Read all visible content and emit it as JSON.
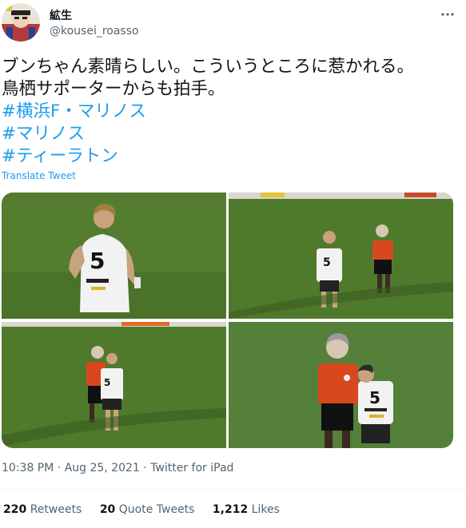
{
  "user": {
    "display_name": "絋生",
    "handle": "@kousei_roasso"
  },
  "tweet": {
    "lines": [
      "ブンちゃん素晴らしい。こういうところに惹かれる。",
      "鳥栖サポーターからも拍手。"
    ],
    "hashtags": [
      "#横浜F・マリノス",
      "#マリノス",
      "#ティーラトン"
    ],
    "translate_label": "Translate Tweet",
    "time": "10:38 PM",
    "date": "Aug 25, 2021",
    "source": "Twitter for iPad"
  },
  "stats": {
    "retweets_count": "220",
    "retweets_label": "Retweets",
    "quotes_count": "20",
    "quotes_label": "Quote Tweets",
    "likes_count": "1,212",
    "likes_label": "Likes"
  },
  "icons": [
    "avatar",
    "more-icon"
  ],
  "colors": {
    "link": "#1d9bf0",
    "secondary_text": "#536471",
    "primary_text": "#0f1419",
    "pitch_green": "#4f7a2c"
  }
}
